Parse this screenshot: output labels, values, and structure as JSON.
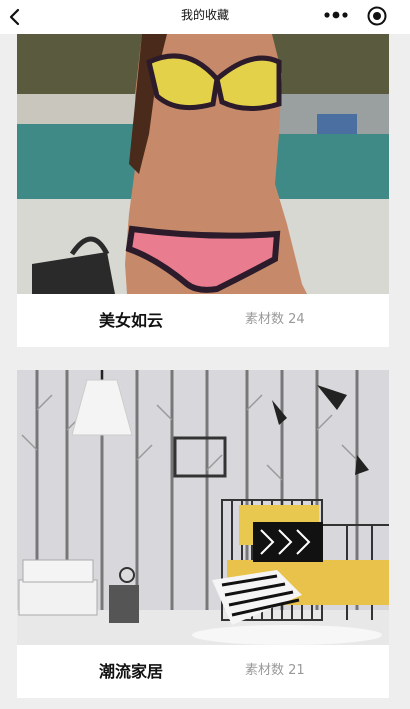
{
  "nav": {
    "title": "我的收藏",
    "back_icon": "chevron-left-icon",
    "more_icon": "more-dots-icon",
    "target_icon": "target-icon"
  },
  "collections": [
    {
      "title": "美女如云",
      "count_label": "素材数",
      "count": "24",
      "image": "swimwear-photo"
    },
    {
      "title": "潮流家居",
      "count_label": "素材数",
      "count": "21",
      "image": "bedroom-interior-photo"
    }
  ],
  "colors": {
    "background": "#eeeeee",
    "card": "#ffffff",
    "count_text": "#999999"
  }
}
